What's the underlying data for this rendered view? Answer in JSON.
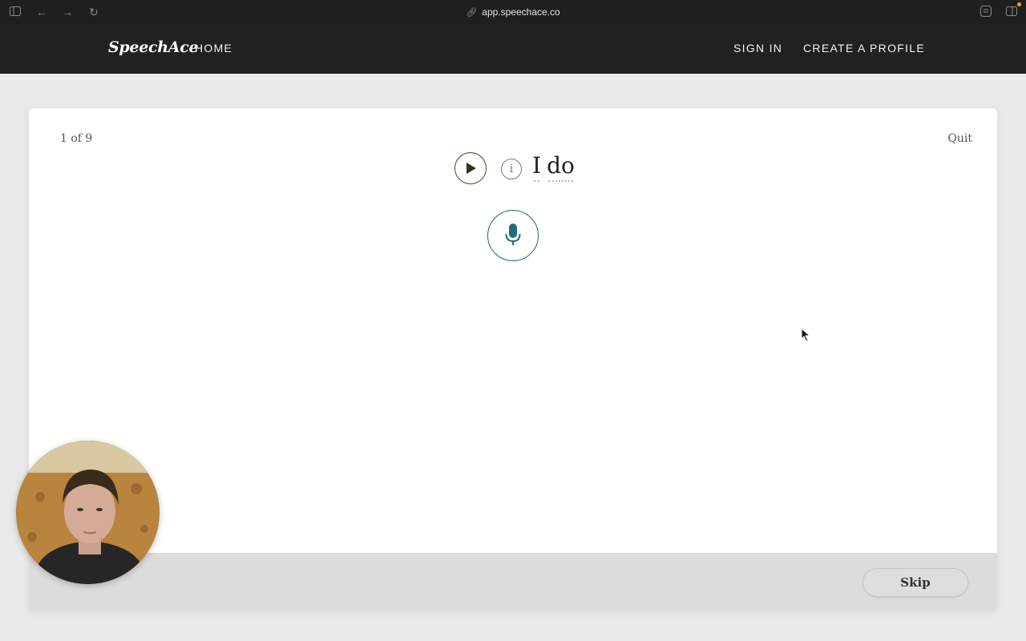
{
  "browser": {
    "url": "app.speechace.co",
    "icons": [
      "sidebar-icon",
      "back-arrow-icon",
      "forward-arrow-icon",
      "reload-icon",
      "link-icon",
      "reader-icon",
      "split-view-icon"
    ]
  },
  "header": {
    "logo": "SpeechAce",
    "home": "HOME",
    "sign_in": "SIGN IN",
    "create_profile": "CREATE A PROFILE"
  },
  "exercise": {
    "progress": "1 of 9",
    "quit": "Quit",
    "info": "i",
    "words": [
      "I",
      "do"
    ]
  },
  "footer": {
    "skip": "Skip"
  },
  "colors": {
    "header_bg": "#212121",
    "play_border": "#3d4a1a",
    "mic_accent": "#1f6d7a"
  }
}
